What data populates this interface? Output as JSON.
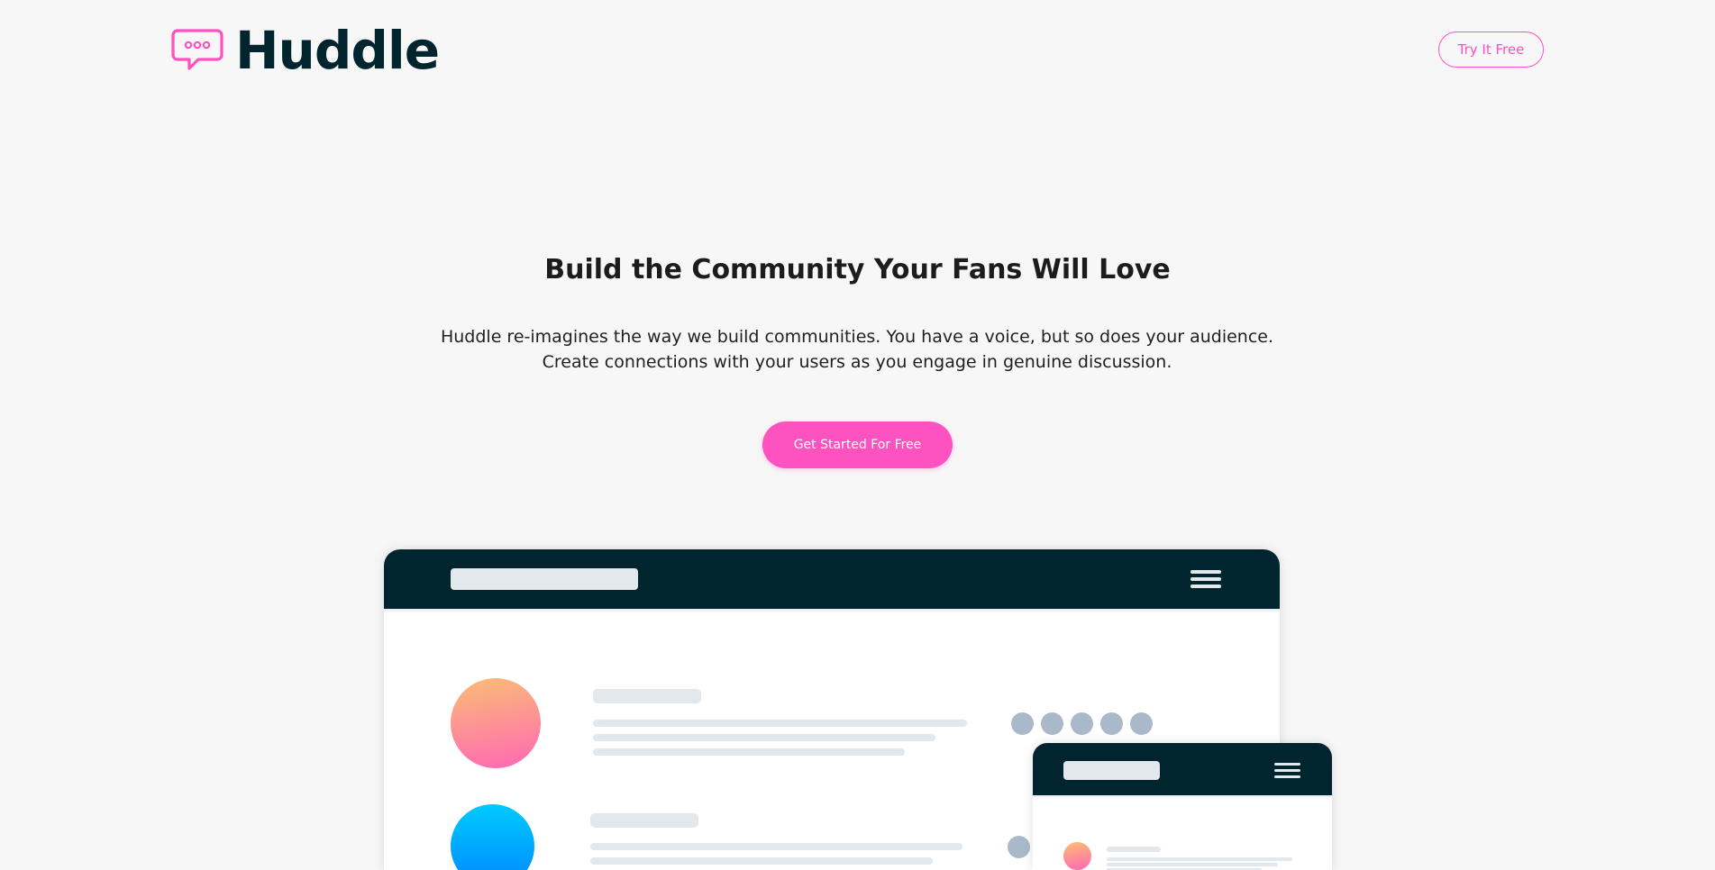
{
  "header": {
    "brand_name": "Huddle",
    "logo_icon": "chat-bubble-icon",
    "try_button_label": "Try It Free"
  },
  "hero": {
    "title": "Build the Community Your Fans Will Love",
    "description": "Huddle re-imagines the way we build communities. You have a voice, but so does your audience. Create connections with your users as you engage in genuine discussion.",
    "cta_label": "Get Started For Free"
  },
  "illustration": {
    "desktop_menu_icon": "hamburger-menu-icon",
    "mobile_menu_icon": "hamburger-menu-icon"
  },
  "colors": {
    "background": "#f7f7f7",
    "primary_dark": "#00252e",
    "accent_pink": "#ff52c1",
    "placeholder_gray": "#e3e8ed",
    "dot_gray": "#aab9c9",
    "avatar_orange": "#fbbd75",
    "avatar_pink": "#ff68b4",
    "avatar_blue": "#00a8ff"
  }
}
